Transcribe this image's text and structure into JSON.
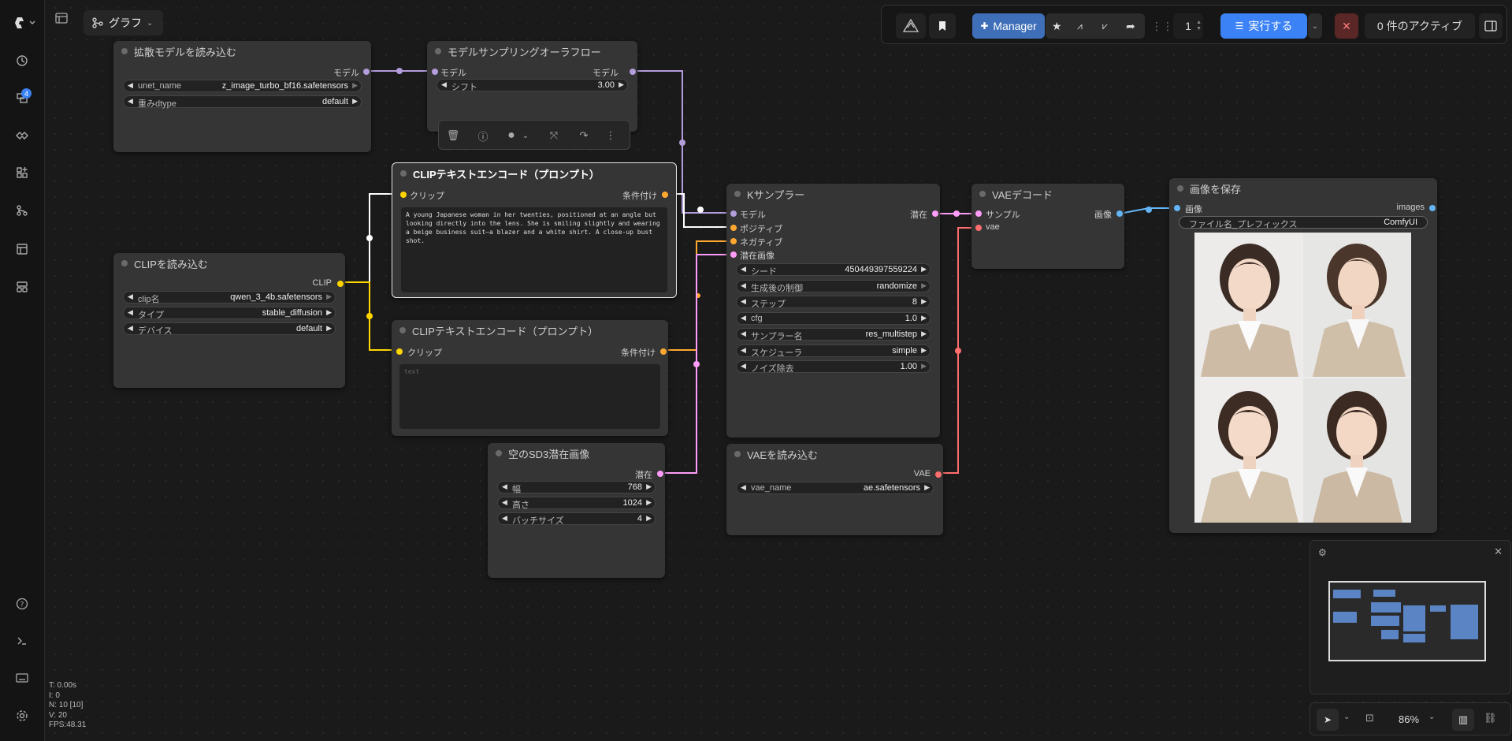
{
  "sidebar": {
    "queue_badge": "4",
    "icons": [
      "comfy-logo-icon",
      "history-icon",
      "queue-icon",
      "model-library-icon",
      "node-library-icon",
      "workflows-icon",
      "templates-icon",
      "layout-icon",
      "help-icon",
      "terminal-icon",
      "keyboard-icon",
      "settings-icon"
    ]
  },
  "stats": {
    "t": "T: 0.00s",
    "i": "I: 0",
    "n": "N: 10 [10]",
    "v": "V: 20",
    "fps": "FPS:48.31"
  },
  "header": {
    "graph_label": "グラフ"
  },
  "toolbar": {
    "manager_label": "Manager",
    "batch_count": "1",
    "run_label": "実行する",
    "active_label": "0 件のアクティブ"
  },
  "nodes": {
    "load_diffusion": {
      "title": "拡散モデルを読み込む",
      "out_model": "モデル",
      "unet_name_label": "unet_name",
      "unet_name_value": "z_image_turbo_bf16.safetensors",
      "dtype_label": "重みdtype",
      "dtype_value": "default"
    },
    "model_sampling": {
      "title": "モデルサンプリングオーラフロー",
      "in_model": "モデル",
      "out_model": "モデル",
      "shift_label": "シフト",
      "shift_value": "3.00"
    },
    "clip_encode_pos": {
      "title": "CLIPテキストエンコード（プロンプト）",
      "in_clip": "クリップ",
      "out_cond": "条件付け",
      "text": "A young Japanese woman in her twenties, positioned at an angle but looking directly into the lens. She is smiling slightly and wearing a beige business suit—a blazer and a white shirt. A close-up bust shot."
    },
    "clip_encode_neg": {
      "title": "CLIPテキストエンコード（プロンプト）",
      "in_clip": "クリップ",
      "out_cond": "条件付け",
      "placeholder": "text"
    },
    "load_clip": {
      "title": "CLIPを読み込む",
      "out_clip": "CLIP",
      "clip_name_label": "clip名",
      "clip_name_value": "qwen_3_4b.safetensors",
      "type_label": "タイプ",
      "type_value": "stable_diffusion",
      "device_label": "デバイス",
      "device_value": "default"
    },
    "ksampler": {
      "title": "Kサンプラー",
      "in_model": "モデル",
      "in_positive": "ポジティブ",
      "in_negative": "ネガティブ",
      "in_latent": "潜在画像",
      "out_latent": "潜在",
      "seed_label": "シード",
      "seed_value": "450449397559224",
      "control_label": "生成後の制御",
      "control_value": "randomize",
      "steps_label": "ステップ",
      "steps_value": "8",
      "cfg_label": "cfg",
      "cfg_value": "1.0",
      "sampler_label": "サンプラー名",
      "sampler_value": "res_multistep",
      "scheduler_label": "スケジューラ",
      "scheduler_value": "simple",
      "denoise_label": "ノイズ除去",
      "denoise_value": "1.00"
    },
    "vae_decode": {
      "title": "VAEデコード",
      "in_samples": "サンプル",
      "in_vae": "vae",
      "out_image": "画像"
    },
    "save_image": {
      "title": "画像を保存",
      "in_images": "画像",
      "out_images": "images",
      "prefix_label": "ファイル名_プレフィックス",
      "prefix_value": "ComfyUI"
    },
    "empty_latent": {
      "title": "空のSD3潜在画像",
      "out_latent": "潜在",
      "width_label": "幅",
      "width_value": "768",
      "height_label": "高さ",
      "height_value": "1024",
      "batch_label": "バッチサイズ",
      "batch_value": "4"
    },
    "load_vae": {
      "title": "VAEを読み込む",
      "out_vae": "VAE",
      "vae_name_label": "vae_name",
      "vae_name_value": "ae.safetensors"
    }
  },
  "zoom": "86%",
  "colors": {
    "model": "#b39ddb",
    "clip": "#ffd500",
    "conditioning": "#ffa931",
    "latent": "#ff9cf9",
    "vae": "#ff6e6e",
    "image": "#64b5f6",
    "accent": "#4a90e2",
    "run": "#3b82f6"
  }
}
